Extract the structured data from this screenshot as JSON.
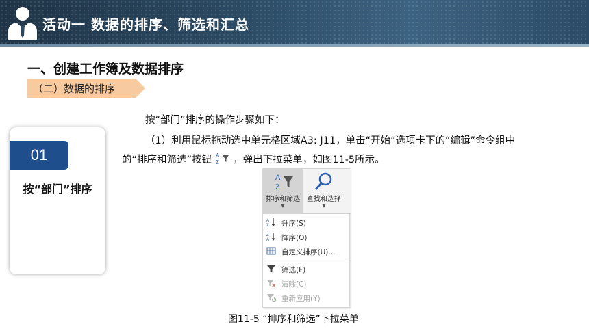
{
  "header": {
    "title": "活动一  数据的排序、筛选和汇总",
    "avatar_icon": "businessman-icon"
  },
  "section": {
    "title": "一、创建工作簿及数据排序",
    "ribbon": "（二）数据的排序"
  },
  "card": {
    "number": "01",
    "label": "按“部门”排序"
  },
  "body": {
    "line1": "按“部门”排序的操作步骤如下：",
    "line2": "（1）利用鼠标拖动选中单元格区域A3: J11，单击“开始”选项卡下的“编辑”命令组中",
    "line3_before": "的“排序和筛选”按钮",
    "line3_after": "，弹出下拉菜单，如图11-5所示。"
  },
  "menu": {
    "sort_filter_button": "排序和筛选",
    "find_select_button": "查找和选择",
    "items": [
      {
        "label": "升序(S)",
        "icon": "sort-ascending-icon",
        "enabled": true
      },
      {
        "label": "降序(O)",
        "icon": "sort-descending-icon",
        "enabled": true
      },
      {
        "label": "自定义排序(U)...",
        "icon": "custom-sort-icon",
        "enabled": true
      },
      {
        "label": "筛选(F)",
        "icon": "filter-icon",
        "enabled": true
      },
      {
        "label": "清除(C)",
        "icon": "clear-filter-icon",
        "enabled": false
      },
      {
        "label": "重新应用(Y)",
        "icon": "reapply-icon",
        "enabled": false
      }
    ]
  },
  "caption": "图11-5 “排序和筛选”下拉菜单",
  "colors": {
    "header": "#2b4a63",
    "ribbon": "#f8caa0",
    "card_number_bg": "#1f4e8c"
  }
}
